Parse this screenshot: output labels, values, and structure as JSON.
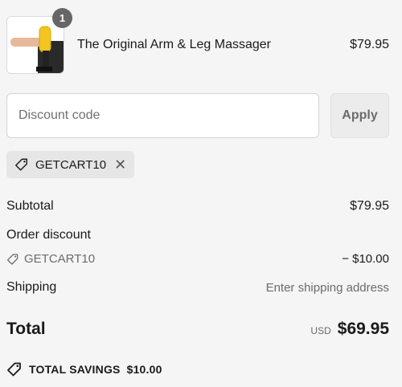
{
  "product": {
    "quantity": "1",
    "name": "The Original Arm & Leg Massager",
    "price": "$79.95",
    "image_icon": "massager-product-image"
  },
  "discount": {
    "placeholder": "Discount code",
    "apply_label": "Apply",
    "applied_code": "GETCART10"
  },
  "summary": {
    "subtotal_label": "Subtotal",
    "subtotal_value": "$79.95",
    "order_discount_label": "Order discount",
    "discount_code": "GETCART10",
    "discount_value": "− $10.00",
    "shipping_label": "Shipping",
    "shipping_value": "Enter shipping address",
    "total_label": "Total",
    "currency": "USD",
    "total_value": "$69.95",
    "savings_label": "TOTAL SAVINGS",
    "savings_value": "$10.00"
  }
}
